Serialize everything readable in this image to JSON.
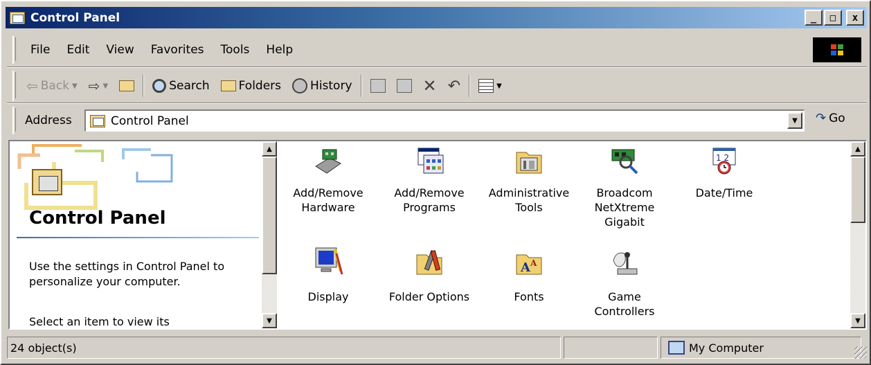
{
  "window": {
    "title": "Control Panel",
    "min_label": "_",
    "max_label": "□",
    "close_label": "x"
  },
  "menu": [
    "File",
    "Edit",
    "View",
    "Favorites",
    "Tools",
    "Help"
  ],
  "toolbar": {
    "back_label": "Back",
    "search_label": "Search",
    "folders_label": "Folders",
    "history_label": "History"
  },
  "address": {
    "label": "Address",
    "value": "Control Panel",
    "go_label": "Go"
  },
  "left_pane": {
    "title": "Control Panel",
    "description": "Use the settings in Control Panel to personalize your computer.",
    "hint": "Select an item to view its"
  },
  "items": [
    {
      "line1": "Add/Remove",
      "line2": "Hardware",
      "line3": "",
      "icon": "hardware-icon"
    },
    {
      "line1": "Add/Remove",
      "line2": "Programs",
      "line3": "",
      "icon": "programs-icon"
    },
    {
      "line1": "Administrative",
      "line2": "Tools",
      "line3": "",
      "icon": "admin-tools-icon"
    },
    {
      "line1": "Broadcom",
      "line2": "NetXtreme",
      "line3": "Gigabit",
      "icon": "network-card-icon"
    },
    {
      "line1": "Date/Time",
      "line2": "",
      "line3": "",
      "icon": "calendar-clock-icon"
    },
    {
      "line1": "Display",
      "line2": "",
      "line3": "",
      "icon": "monitor-icon"
    },
    {
      "line1": "Folder Options",
      "line2": "",
      "line3": "",
      "icon": "folder-options-icon"
    },
    {
      "line1": "Fonts",
      "line2": "",
      "line3": "",
      "icon": "fonts-folder-icon"
    },
    {
      "line1": "Game",
      "line2": "Controllers",
      "line3": "",
      "icon": "joystick-icon"
    }
  ],
  "status": {
    "count": "24 object(s)",
    "zone": "My Computer"
  },
  "colors": {
    "title_start": "#0a246a",
    "title_end": "#a6caf0",
    "chrome": "#d4d0c8"
  }
}
